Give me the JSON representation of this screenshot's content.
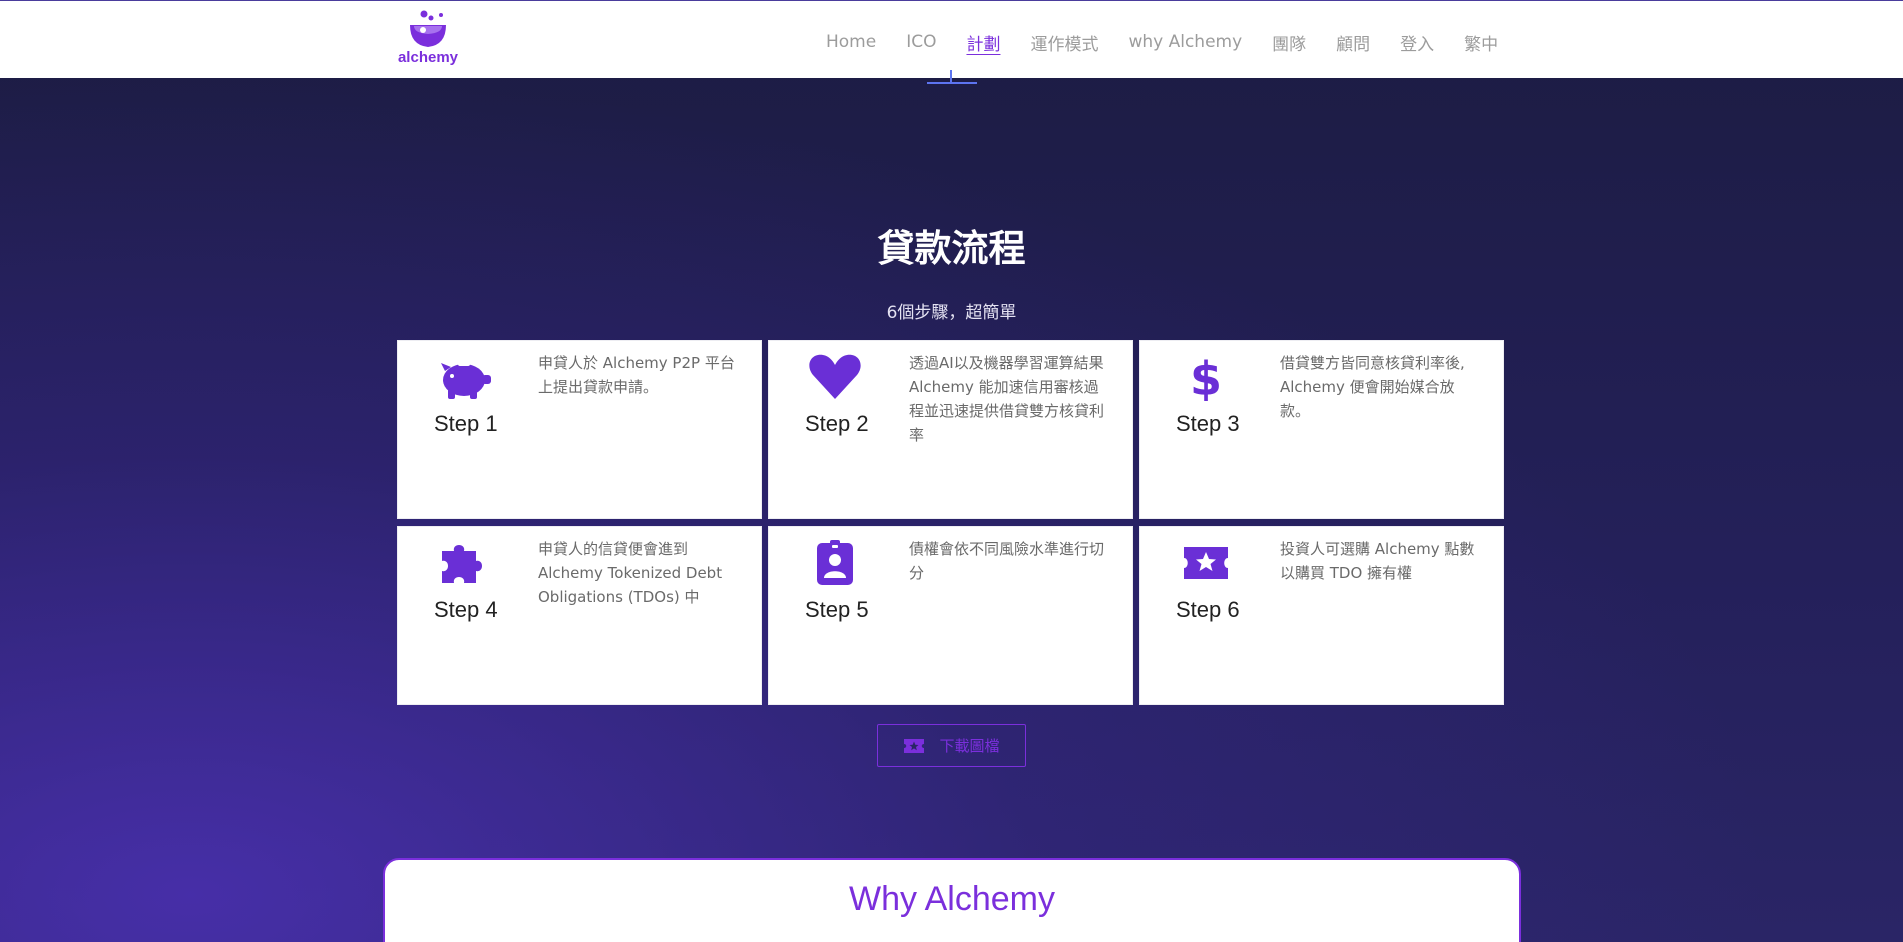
{
  "brand": {
    "name": "alchemy",
    "accent": "#7b2fdc",
    "icon": "flask-logo"
  },
  "nav": {
    "items": [
      {
        "label": "Home",
        "active": false
      },
      {
        "label": "ICO",
        "active": false
      },
      {
        "label": "計劃",
        "active": true
      },
      {
        "label": "運作模式",
        "active": false
      },
      {
        "label": "why Alchemy",
        "active": false
      },
      {
        "label": "團隊",
        "active": false
      },
      {
        "label": "顧問",
        "active": false
      },
      {
        "label": "登入",
        "active": false
      },
      {
        "label": "繁中",
        "active": false
      }
    ]
  },
  "loan_process": {
    "title": "貸款流程",
    "subtitle": "6個步驟，超簡單",
    "steps": [
      {
        "label": "Step 1",
        "icon": "piggy-bank-icon",
        "desc": "申貸人於 Alchemy P2P 平台上提出貸款申請。"
      },
      {
        "label": "Step 2",
        "icon": "heart-icon",
        "desc": "透過AI以及機器學習運算結果 Alchemy 能加速信用審核過程並迅速提供借貸雙方核貸利率"
      },
      {
        "label": "Step 3",
        "icon": "dollar-icon",
        "desc": "借貸雙方皆同意核貸利率後, Alchemy 便會開始媒合放款。"
      },
      {
        "label": "Step 4",
        "icon": "puzzle-icon",
        "desc": "申貸人的信貸便會進到 Alchemy Tokenized Debt Obligations (TDOs) 中"
      },
      {
        "label": "Step 5",
        "icon": "id-badge-icon",
        "desc": "債權會依不同風險水準進行切分"
      },
      {
        "label": "Step 6",
        "icon": "ticket-star-icon",
        "desc": "投資人可選購 Alchemy 點數以購買 TDO 擁有權"
      }
    ],
    "download_button": {
      "label": "下載圖檔",
      "icon": "ticket-star-icon"
    }
  },
  "why_alchemy": {
    "title": "Why Alchemy"
  }
}
